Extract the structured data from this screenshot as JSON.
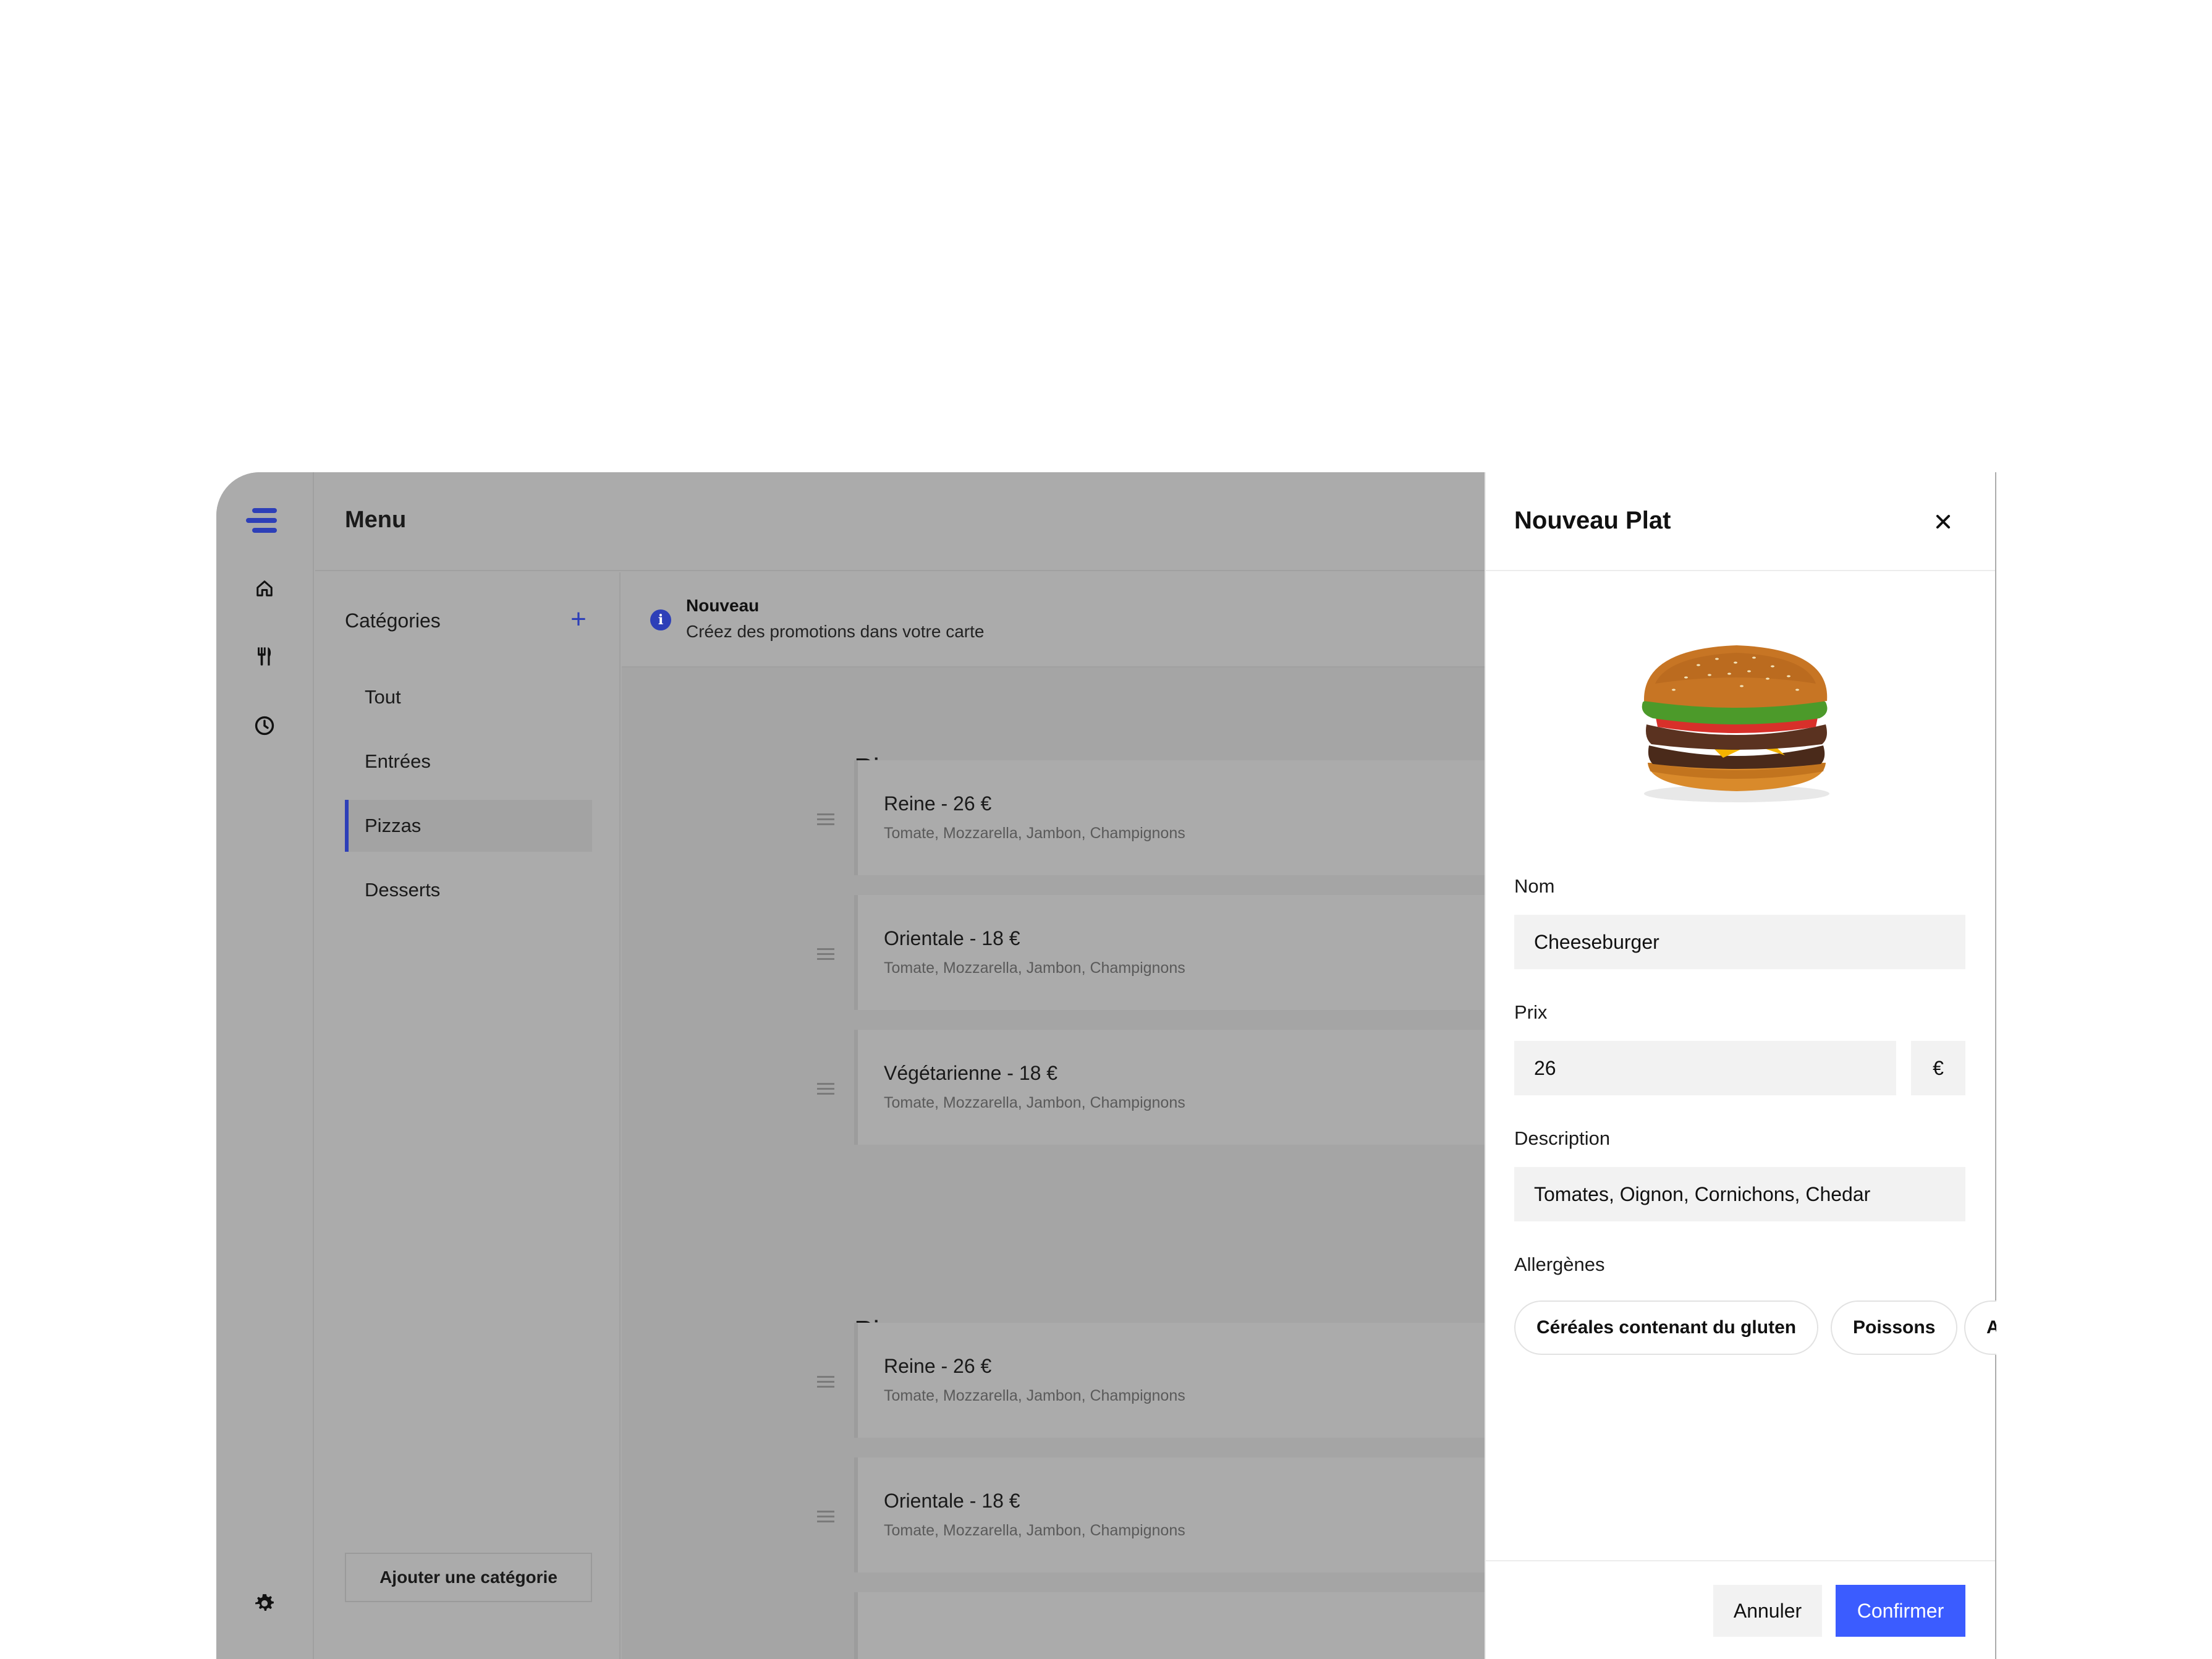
{
  "header": {
    "title": "Menu"
  },
  "rail": {
    "icons": [
      "menu-logo-icon",
      "home-icon",
      "cutlery-icon",
      "clock-icon",
      "settings-icon"
    ]
  },
  "categories": {
    "heading": "Catégories",
    "add_symbol": "+",
    "items": [
      {
        "label": "Tout",
        "active": false
      },
      {
        "label": "Entrées",
        "active": false
      },
      {
        "label": "Pizzas",
        "active": true
      },
      {
        "label": "Desserts",
        "active": false
      }
    ],
    "add_button_label": "Ajouter une catégorie"
  },
  "banner": {
    "title": "Nouveau",
    "subtitle": "Créez des promotions dans votre carte"
  },
  "sections": [
    {
      "title": "Pizzas",
      "dishes": [
        {
          "name": "Reine - 26 €",
          "ingredients": "Tomate, Mozzarella, Jambon, Champignons"
        },
        {
          "name": "Orientale - 18 €",
          "ingredients": "Tomate, Mozzarella, Jambon, Champignons"
        },
        {
          "name": "Végétarienne - 18 €",
          "ingredients": "Tomate, Mozzarella, Jambon, Champignons"
        }
      ]
    },
    {
      "title": "Pizzas",
      "dishes": [
        {
          "name": "Reine - 26 €",
          "ingredients": "Tomate, Mozzarella, Jambon, Champignons"
        },
        {
          "name": "Orientale - 18 €",
          "ingredients": "Tomate, Mozzarella, Jambon, Champignons"
        }
      ]
    }
  ],
  "drawer": {
    "title": "Nouveau Plat",
    "name_label": "Nom",
    "name_value": "Cheeseburger",
    "price_label": "Prix",
    "price_value": "26",
    "currency": "€",
    "description_label": "Description",
    "description_value": "Tomates, Oignon, Cornichons, Chedar",
    "allergens_label": "Allergènes",
    "allergens": [
      "Céréales contenant du gluten",
      "Poissons",
      "A"
    ],
    "cancel_label": "Annuler",
    "confirm_label": "Confirmer"
  },
  "colors": {
    "accent": "#2d3fb8",
    "confirm": "#3b5cff",
    "overlay_gray": "#ababab"
  }
}
